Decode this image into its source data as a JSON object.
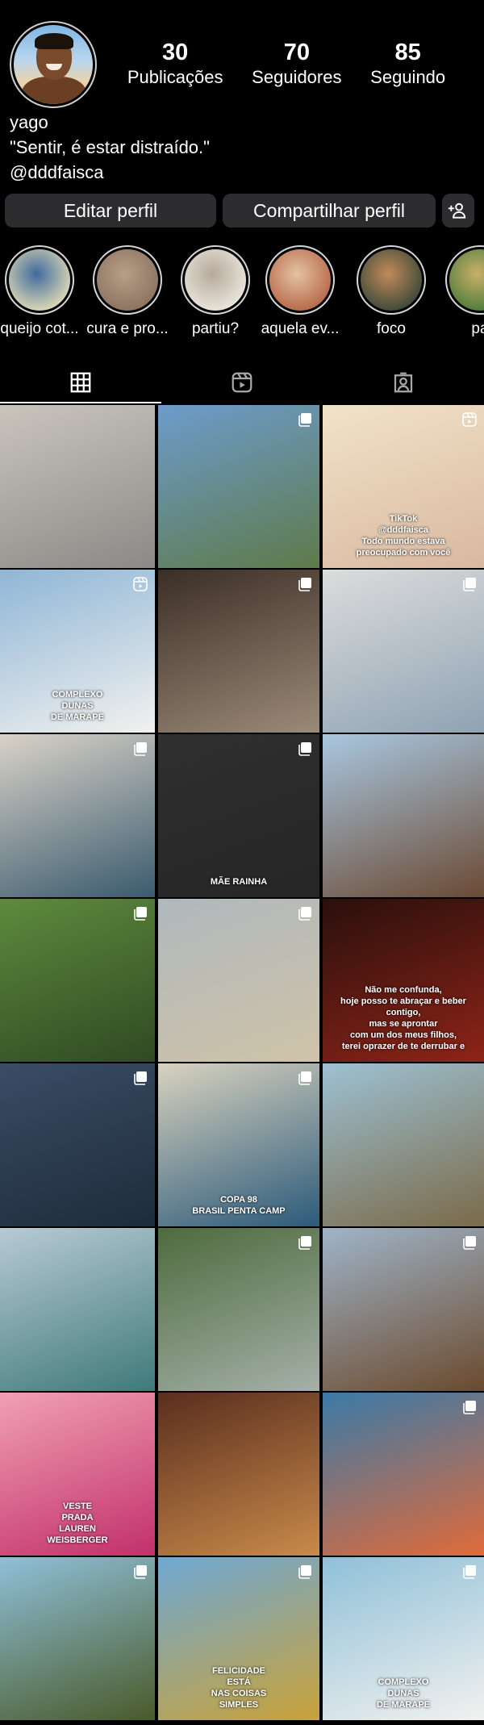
{
  "profile": {
    "username": "yago",
    "bio_quote": "\"Sentir, é estar distraído.\"",
    "bio_handle": "@dddfaisca",
    "stats": [
      {
        "value": "30",
        "label": "Publicações"
      },
      {
        "value": "70",
        "label": "Seguidores"
      },
      {
        "value": "85",
        "label": "Seguindo"
      }
    ]
  },
  "actions": {
    "edit_label": "Editar perfil",
    "share_label": "Compartilhar perfil",
    "add_icon": "add-person-icon"
  },
  "highlights": [
    {
      "label": "queijo cot...",
      "colors": [
        "#dcd8b4",
        "#3f6a9e"
      ]
    },
    {
      "label": "cura e pro...",
      "colors": [
        "#8d7461",
        "#b79e87"
      ]
    },
    {
      "label": "partiu?",
      "colors": [
        "#e9e5dc",
        "#b6a99a"
      ]
    },
    {
      "label": "aquela ev...",
      "colors": [
        "#b86b4a",
        "#e4c2a4"
      ]
    },
    {
      "label": "foco",
      "colors": [
        "#3f4a3a",
        "#c28b5a"
      ]
    },
    {
      "label": "pa",
      "colors": [
        "#4f7d3b",
        "#c9b06a"
      ]
    }
  ],
  "tabs": [
    {
      "name": "tab-posts",
      "icon": "grid-icon"
    },
    {
      "name": "tab-reels",
      "icon": "reels-icon"
    },
    {
      "name": "tab-tagged",
      "icon": "tagged-icon"
    }
  ],
  "posts": [
    {
      "colors": [
        "#c9c5bd",
        "#8b8a86"
      ],
      "badge": "none"
    },
    {
      "colors": [
        "#6d9ccc",
        "#5e7a4a"
      ],
      "badge": "multi"
    },
    {
      "colors": [
        "#f1e3c8",
        "#d9b8a0"
      ],
      "badge": "reel",
      "lines": [
        "TikTok",
        "@dddfaisca",
        "Todo mundo estava",
        "preocupado com você"
      ]
    },
    {
      "colors": [
        "#8fb6d6",
        "#f1f1ef"
      ],
      "badge": "reel",
      "lines": [
        "COMPLEXO",
        "DUNAS",
        "DE MARAPE"
      ]
    },
    {
      "colors": [
        "#3a2e26",
        "#9c8a78"
      ],
      "badge": "multi"
    },
    {
      "colors": [
        "#dcdcdc",
        "#8fa3b3"
      ],
      "badge": "multi"
    },
    {
      "colors": [
        "#d9d2c8",
        "#3b5b6e"
      ],
      "badge": "multi"
    },
    {
      "colors": [
        "#2f2f2f",
        "#262626"
      ],
      "badge": "multi",
      "lines": [
        "MÃE RAINHA"
      ]
    },
    {
      "colors": [
        "#a9c7e0",
        "#6a4a34"
      ],
      "badge": "none"
    },
    {
      "colors": [
        "#5e8a3e",
        "#2f4a22"
      ],
      "badge": "multi"
    },
    {
      "colors": [
        "#b0b8bd",
        "#cfc3a8"
      ],
      "badge": "multi"
    },
    {
      "colors": [
        "#2a0f0c",
        "#8d2418"
      ],
      "badge": "none",
      "lines": [
        "Não me confunda,",
        "hoje posso te abraçar e beber contigo,",
        "mas se aprontar",
        "com um dos meus filhos,",
        "terei oprazer de te derrubar e"
      ]
    },
    {
      "colors": [
        "#3a4d66",
        "#1e2b3a"
      ],
      "badge": "multi"
    },
    {
      "colors": [
        "#d8d2bf",
        "#2c5a7a"
      ],
      "badge": "multi",
      "lines": [
        "COPA 98",
        "BRASIL PENTA CAMP"
      ]
    },
    {
      "colors": [
        "#9dc1d2",
        "#7a6a4a"
      ],
      "badge": "none"
    },
    {
      "colors": [
        "#b8cad4",
        "#3f7a7a"
      ],
      "badge": "none"
    },
    {
      "colors": [
        "#4e6b3e",
        "#a5b0a8"
      ],
      "badge": "multi"
    },
    {
      "colors": [
        "#9fb4c8",
        "#6b4a2e"
      ],
      "badge": "multi"
    },
    {
      "colors": [
        "#f0a0b4",
        "#c2306a"
      ],
      "badge": "none",
      "lines": [
        "VESTE",
        "PRADA",
        "LAUREN",
        "WEISBERGER"
      ]
    },
    {
      "colors": [
        "#5a2e1e",
        "#c98a4a"
      ],
      "badge": "none"
    },
    {
      "colors": [
        "#3a7aa8",
        "#e06a3a"
      ],
      "badge": "multi"
    },
    {
      "colors": [
        "#8fc0d8",
        "#4a5a2a"
      ],
      "badge": "multi"
    },
    {
      "colors": [
        "#6fa8d4",
        "#c9a23a"
      ],
      "badge": "multi",
      "lines": [
        "FELICIDADE",
        "ESTÁ",
        "NAS COISAS",
        "SIMPLES"
      ]
    },
    {
      "colors": [
        "#8fc0d8",
        "#f1f1ef"
      ],
      "badge": "multi",
      "lines": [
        "COMPLEXO",
        "DUNAS",
        "DE MARAPE"
      ]
    }
  ]
}
